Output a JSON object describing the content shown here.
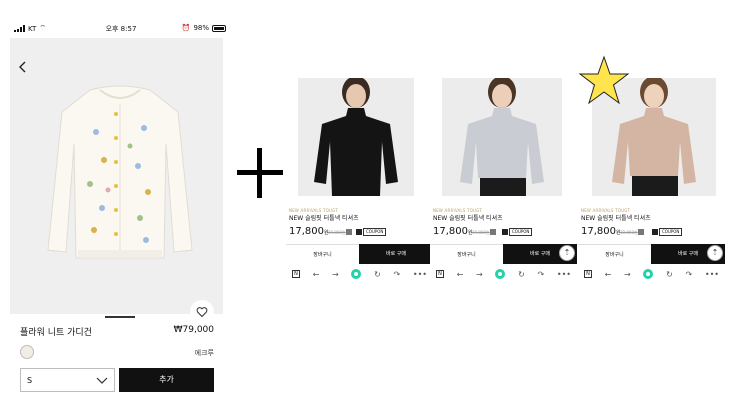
{
  "status_bar": {
    "carrier": "KT",
    "time": "오후 8:57",
    "battery": "98%"
  },
  "product": {
    "name": "플라워 니트 가디건",
    "price": "₩79,000",
    "color_name": "에크루",
    "size": "S",
    "add_button": "추가"
  },
  "panels": [
    {
      "tag": "NEW ARRIVALS TOUGT",
      "title": "NEW 슬림핏 터틀넥 티셔츠",
      "price": "17,800",
      "won": "원",
      "old_price": "19,800원",
      "coupon": "COUPON",
      "cart": "장바구니",
      "buy": "바로 구매",
      "shirt_color": "#141414"
    },
    {
      "tag": "NEW ARRIVALS TOUGT",
      "title": "NEW 슬림핏 터틀넥 티셔츠",
      "price": "17,800",
      "won": "원",
      "old_price": "19,800원",
      "coupon": "COUPON",
      "cart": "장바구니",
      "buy": "바로 구매",
      "shirt_color": "#c9ccd2"
    },
    {
      "tag": "NEW ARRIVALS TOUGT",
      "title": "NEW 슬림핏 터틀넥 티셔츠",
      "price": "17,800",
      "won": "원",
      "old_price": "19,800원",
      "coupon": "COUPON",
      "cart": "장바구니",
      "buy": "바로 구매",
      "shirt_color": "#d4b5a3"
    }
  ],
  "icons": [
    "back-icon",
    "heart-icon",
    "chevron-down-icon",
    "plus-icon",
    "star-icon",
    "scroll-top-icon",
    "n-logo-icon",
    "arrow-left-icon",
    "arrow-right-icon",
    "home-icon",
    "refresh-icon",
    "share-icon",
    "more-icon"
  ],
  "colors": {
    "accent": "#1fd3a8",
    "star": "#ffe44d",
    "buy_button": "#111111"
  }
}
